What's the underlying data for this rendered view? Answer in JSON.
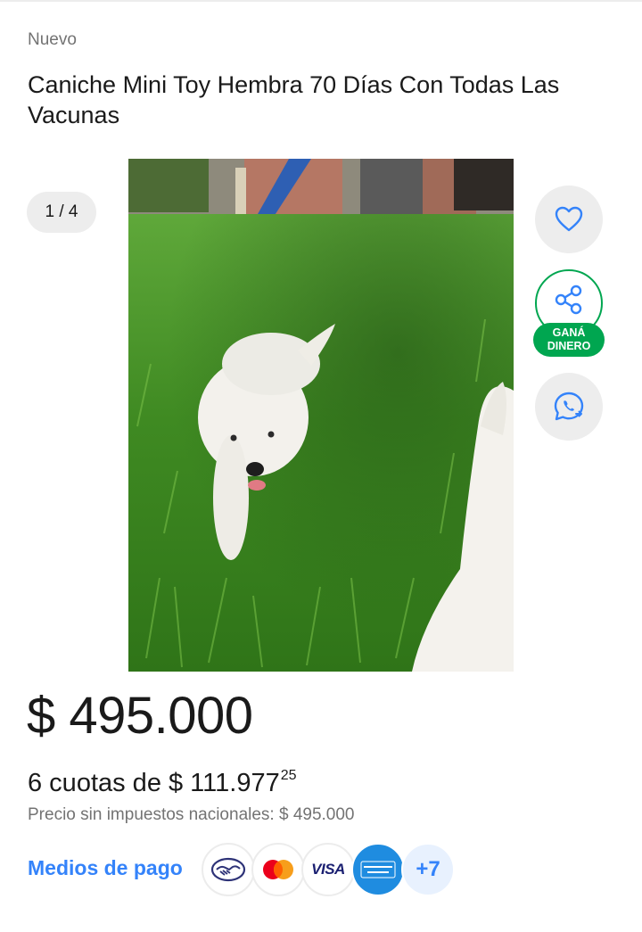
{
  "listing": {
    "condition": "Nuevo",
    "title": "Caniche Mini Toy Hembra 70 Días Con Todas Las Vacunas"
  },
  "gallery": {
    "counter": "1 / 4",
    "image_subject": "white toy poodle puppy on green grass"
  },
  "actions": {
    "favorite_icon": "heart-icon",
    "share_icon": "share-icon",
    "share_badge_line1": "GANÁ",
    "share_badge_line2": "DINERO",
    "whatsapp_icon": "whatsapp-icon"
  },
  "pricing": {
    "price": "$ 495.000",
    "installments_text": "6 cuotas de $ 111.977",
    "installments_cents": "25",
    "tax_note": "Precio sin impuestos nacionales: $ 495.000"
  },
  "payment": {
    "label": "Medios de pago",
    "methods": [
      "mercado-pago-icon",
      "mastercard-icon",
      "visa-icon",
      "amex-icon"
    ],
    "visa_text": "VISA",
    "more": "+7"
  },
  "colors": {
    "accent": "#3483fa",
    "green": "#00a650",
    "text": "#1a1a1a",
    "muted": "#737373"
  }
}
